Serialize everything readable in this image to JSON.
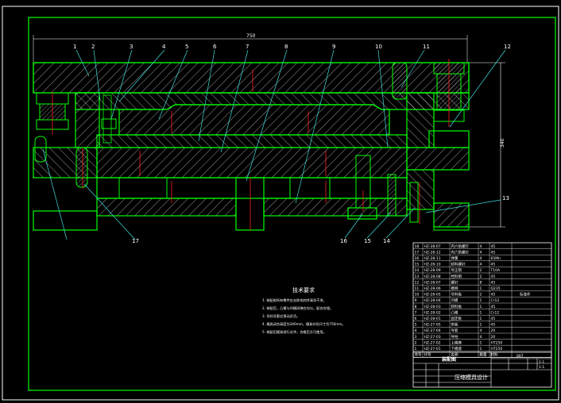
{
  "drawing": {
    "overall_width_dim": "750",
    "overall_height_dim": "340",
    "part_numbers": [
      "1",
      "2",
      "3",
      "4",
      "5",
      "6",
      "7",
      "8",
      "9",
      "10",
      "11",
      "12",
      "13",
      "14",
      "15",
      "16",
      "17"
    ],
    "notes_title": "技术要求",
    "notes": [
      "1. 装配前所有零件应去除毛刺并清洗干净。",
      "2. 装配后，凸模与凹模间隙应均匀，配合合理。",
      "3. 导柱导套应滑动灵活。",
      "4. 模具闭合高度为340mm，模具外形尺寸为750mm。",
      "5. 装配后模具进行试冲，合格后方可使用。"
    ],
    "bom_rows": [
      {
        "no": "18",
        "code": "HZ-28-07",
        "name": "内六角螺钉",
        "qty": "4",
        "mat": "45"
      },
      {
        "no": "17",
        "code": "HZ-28-12",
        "name": "内六角螺钉",
        "qty": "4",
        "mat": "45"
      },
      {
        "no": "16",
        "code": "HZ-28-11",
        "name": "弹簧",
        "qty": "4",
        "mat": "65Mn"
      },
      {
        "no": "15",
        "code": "HZ-28-10",
        "name": "卸料螺钉",
        "qty": "4",
        "mat": "45"
      },
      {
        "no": "14",
        "code": "HZ-28-09",
        "name": "导正销",
        "qty": "2",
        "mat": "T10A"
      },
      {
        "no": "13",
        "code": "HZ-28-08",
        "name": "挡料销",
        "qty": "2",
        "mat": "45"
      },
      {
        "no": "12",
        "code": "HZ-28-07",
        "name": "螺钉",
        "qty": "8",
        "mat": "45"
      },
      {
        "no": "11",
        "code": "HZ-28-06",
        "name": "模柄",
        "qty": "1",
        "mat": "Q235"
      },
      {
        "no": "10",
        "code": "HZ-28-05",
        "name": "导料板",
        "qty": "2",
        "mat": "45"
      },
      {
        "no": "9",
        "code": "HZ-28-04",
        "name": "凹模",
        "qty": "1",
        "mat": "Cr12"
      },
      {
        "no": "8",
        "code": "HZ-28-03",
        "name": "卸料板",
        "qty": "1",
        "mat": "45"
      },
      {
        "no": "7",
        "code": "HZ-28-02",
        "name": "凸模",
        "qty": "1",
        "mat": "Cr12"
      },
      {
        "no": "6",
        "code": "HZ-28-01",
        "name": "固定板",
        "qty": "1",
        "mat": "45"
      },
      {
        "no": "5",
        "code": "HZ-27-05",
        "name": "垫板",
        "qty": "1",
        "mat": "45"
      },
      {
        "no": "4",
        "code": "HZ-27-04",
        "name": "导套",
        "qty": "4",
        "mat": "20"
      },
      {
        "no": "3",
        "code": "HZ-27-03",
        "name": "导柱",
        "qty": "4",
        "mat": "20"
      },
      {
        "no": "2",
        "code": "HZ-27-02",
        "name": "上模座",
        "qty": "1",
        "mat": "HT250"
      },
      {
        "no": "1",
        "code": "HZ-27-01",
        "name": "下模座",
        "qty": "1",
        "mat": "HT250"
      }
    ],
    "bom_header": {
      "no": "序号",
      "code": "代号",
      "name": "名称",
      "qty": "数量",
      "mat": "材料"
    },
    "title_block": {
      "title": "装配图",
      "drawing_no": "007",
      "scale": "1:1",
      "sheet": "1:1",
      "subtitle": "压缩模具设计",
      "remark": "标准件"
    }
  }
}
